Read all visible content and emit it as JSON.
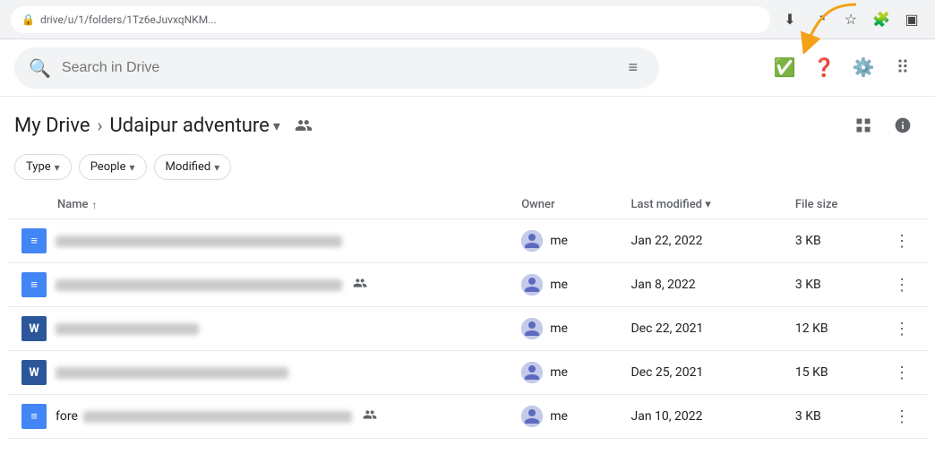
{
  "browser": {
    "url": "drive/u/1/folders/1Tz6eJuvxqNKM...",
    "icons": [
      "download",
      "share",
      "star",
      "extensions",
      "sidebar"
    ]
  },
  "header": {
    "search_placeholder": "Search in Drive",
    "filter_icon": "≡",
    "icons": [
      "check-circle",
      "help",
      "settings",
      "apps"
    ]
  },
  "breadcrumb": {
    "my_drive": "My Drive",
    "separator": "›",
    "folder_name": "Udaipur adventure",
    "folder_chevron": "▾",
    "share_icon": "👤"
  },
  "filters": [
    {
      "label": "Type",
      "chevron": "▾"
    },
    {
      "label": "People",
      "chevron": "▾"
    },
    {
      "label": "Modified",
      "chevron": "▾"
    }
  ],
  "table": {
    "columns": [
      {
        "key": "name",
        "label": "Name",
        "sort": "↑"
      },
      {
        "key": "owner",
        "label": "Owner"
      },
      {
        "key": "modified",
        "label": "Last modified",
        "sort": "▾"
      },
      {
        "key": "size",
        "label": "File size"
      }
    ],
    "rows": [
      {
        "id": 1,
        "icon_type": "docs",
        "icon_label": "≡",
        "name_blur_width": "320",
        "shared": false,
        "shared_people": false,
        "owner": "me",
        "modified": "Jan 22, 2022",
        "size": "3 KB"
      },
      {
        "id": 2,
        "icon_type": "docs",
        "icon_label": "≡",
        "name_blur_width": "320",
        "shared": false,
        "shared_people": true,
        "owner": "me",
        "modified": "Jan 8, 2022",
        "size": "3 KB"
      },
      {
        "id": 3,
        "icon_type": "word",
        "icon_label": "W",
        "name_blur_width": "160",
        "shared": false,
        "shared_people": false,
        "owner": "me",
        "modified": "Dec 22, 2021",
        "size": "12 KB"
      },
      {
        "id": 4,
        "icon_type": "word",
        "icon_label": "W",
        "name_blur_width": "260",
        "shared": false,
        "shared_people": false,
        "owner": "me",
        "modified": "Dec 25, 2021",
        "size": "15 KB"
      },
      {
        "id": 5,
        "icon_type": "docs",
        "icon_label": "≡",
        "name_blur_width": "300",
        "shared": false,
        "shared_people": true,
        "name_prefix": "fore",
        "owner": "me",
        "modified": "Jan 10, 2022",
        "size": "3 KB"
      }
    ]
  },
  "more_button_label": "⋮",
  "view_grid_icon": "⊞",
  "info_icon": "ℹ"
}
